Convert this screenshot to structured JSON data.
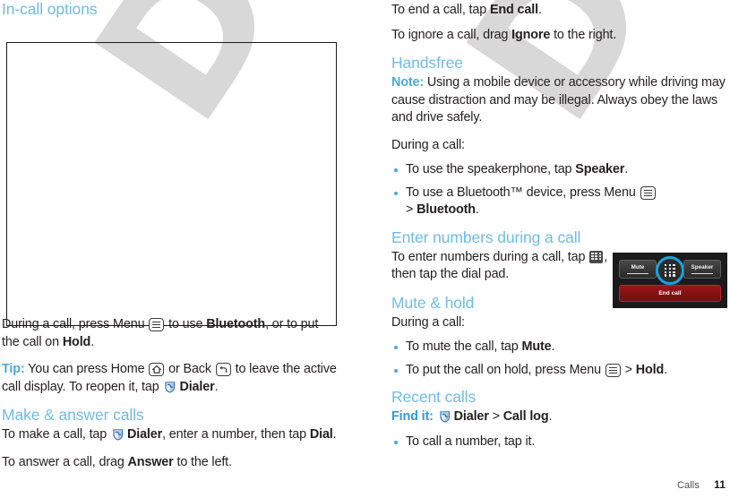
{
  "watermark": {
    "text": "DRAFT",
    "color": "#d8d8d8"
  },
  "theme": {
    "heading_color": "#6fbbe8",
    "accent_blue": "#4aa8e0",
    "end_call_red": "#9f1318",
    "highlight_ring": "#19a3dd",
    "body_text": "#231f20"
  },
  "left_column": {
    "heading_incall": "In-call options",
    "figure": {
      "name": "in-call-screen-illustration",
      "caption": ""
    },
    "para_during_call": {
      "t1": "During a call, press Menu ",
      "icon_menu": "menu-icon",
      "t2": " to use ",
      "b1": "Bluetooth",
      "t3": ", or to put the call on ",
      "b2": "Hold",
      "t4": "."
    },
    "para_tip": {
      "label": "Tip:",
      "t1": " You can press Home ",
      "icon_home": "home-icon",
      "t2": " or Back ",
      "icon_back": "back-icon",
      "t3": " to leave the active call display. To reopen it, tap ",
      "icon_dialer": "dialer-icon",
      "b1": "Dialer",
      "t4": "."
    },
    "heading_make_answer": "Make & answer calls",
    "para_make": {
      "t1": "To make a call, tap ",
      "icon_dialer": "dialer-icon",
      "b1": "Dialer",
      "t2": ", enter a number, then tap ",
      "b2": "Dial",
      "t3": "."
    },
    "para_answer": {
      "t1": "To answer a call, drag ",
      "b1": "Answer",
      "t2": " to the left."
    }
  },
  "right_column": {
    "para_end": {
      "t1": "To end a call, tap ",
      "b1": "End call",
      "t2": "."
    },
    "para_ignore": {
      "t1": "To ignore a call, drag ",
      "b1": "Ignore",
      "t2": " to the right."
    },
    "heading_handsfree": "Handsfree",
    "para_note": {
      "label": "Note:",
      "t1": " Using a mobile device or accessory while driving may cause distraction and may be illegal. Always obey the laws and drive safely."
    },
    "para_during_call_1": "During a call:",
    "bullets_handsfree": [
      {
        "t1": "To use the speakerphone, tap ",
        "b1": "Speaker",
        "t2": "."
      },
      {
        "t1": "To use a Bluetooth™ device, press Menu ",
        "icon_menu": "menu-icon",
        "t2": " > ",
        "b1": "Bluetooth",
        "t3": "."
      }
    ],
    "heading_enter_numbers": "Enter numbers during a call",
    "para_enter_numbers": {
      "t1": "To enter numbers during a call, tap ",
      "icon_dialpad": "dialpad-icon",
      "t2": ", then tap the dial pad."
    },
    "heading_mute_hold": "Mute & hold",
    "para_during_call_2": "During a call:",
    "bullets_mute": [
      {
        "t1": "To mute the call, tap ",
        "b1": "Mute",
        "t2": "."
      },
      {
        "t1": "To put the call on hold, press Menu ",
        "icon_menu": "menu-icon",
        "t2": " > ",
        "b1": "Hold",
        "t3": "."
      }
    ],
    "heading_recent_calls": "Recent calls",
    "para_find_it": {
      "label": "Find it:",
      "icon_dialer": "dialer-icon",
      "b1": "Dialer",
      "sep": " > ",
      "b2": "Call log",
      "t1": "."
    },
    "bullets_recent": [
      {
        "t1": "To call a number, tap it."
      }
    ]
  },
  "call_inset": {
    "mute_label": "Mute",
    "speaker_label": "Speaker",
    "dialpad_label": "dialpad-icon",
    "end_call_label": "End call"
  },
  "footer": {
    "section": "Calls",
    "page_number": "11"
  }
}
